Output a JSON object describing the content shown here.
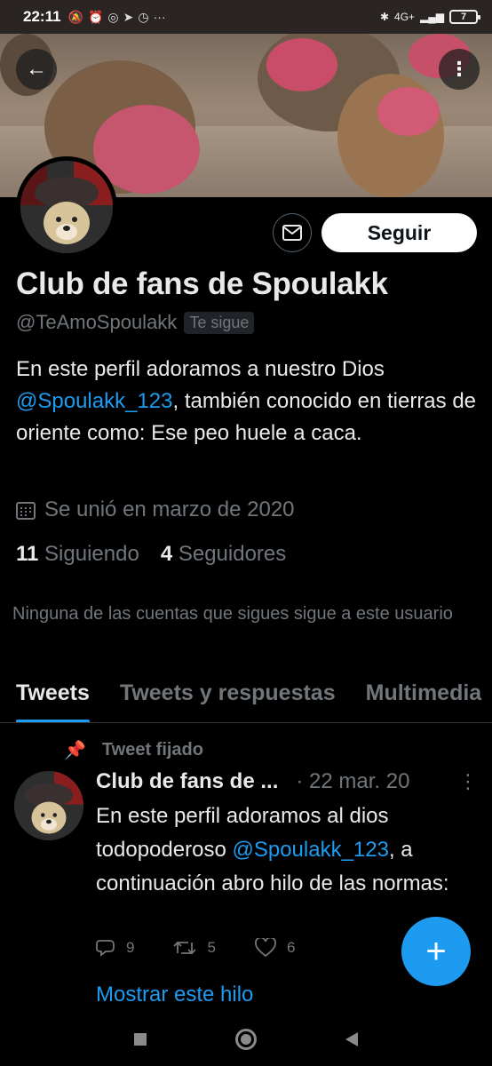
{
  "status_bar": {
    "time": "22:11",
    "icons": [
      "mute-icon",
      "alarm-icon",
      "whatsapp-icon",
      "telegram-icon",
      "alarm-icon",
      "more-icon"
    ],
    "network": "4G+",
    "battery": "7"
  },
  "profile": {
    "name": "Club de fans de Spoulakk",
    "handle": "@TeAmoSpoulakk",
    "follows_you": "Te sigue",
    "follow_label": "Seguir",
    "bio_part1": "En este perfil adoramos a nuestro Dios ",
    "bio_mention": "@Spoulakk_123",
    "bio_part2": ", también conocido en tierras de oriente como: Ese peo huele a caca.",
    "joined": "Se unió en marzo de 2020",
    "following_count": "11",
    "following_label": "Siguiendo",
    "followers_count": "4",
    "followers_label": "Seguidores",
    "no_mutual": "Ninguna de las cuentas que sigues sigue a este usuario"
  },
  "tabs": [
    {
      "label": "Tweets",
      "active": true
    },
    {
      "label": "Tweets y respuestas",
      "active": false
    },
    {
      "label": "Multimedia",
      "active": false
    }
  ],
  "pinned_tweet": {
    "pinned_label": "Tweet fijado",
    "author": "Club de fans de ...",
    "date": "· 22 mar. 20",
    "text_part1": "En este perfil adoramos al dios todopoderoso ",
    "text_mention": "@Spoulakk_123",
    "text_part2": ", a continuación abro hilo de las normas:",
    "replies": "9",
    "retweets": "5",
    "likes": "6",
    "show_thread": "Mostrar este hilo"
  },
  "colors": {
    "accent": "#1d9bf0",
    "background": "#000000",
    "secondary_text": "#71767b"
  }
}
